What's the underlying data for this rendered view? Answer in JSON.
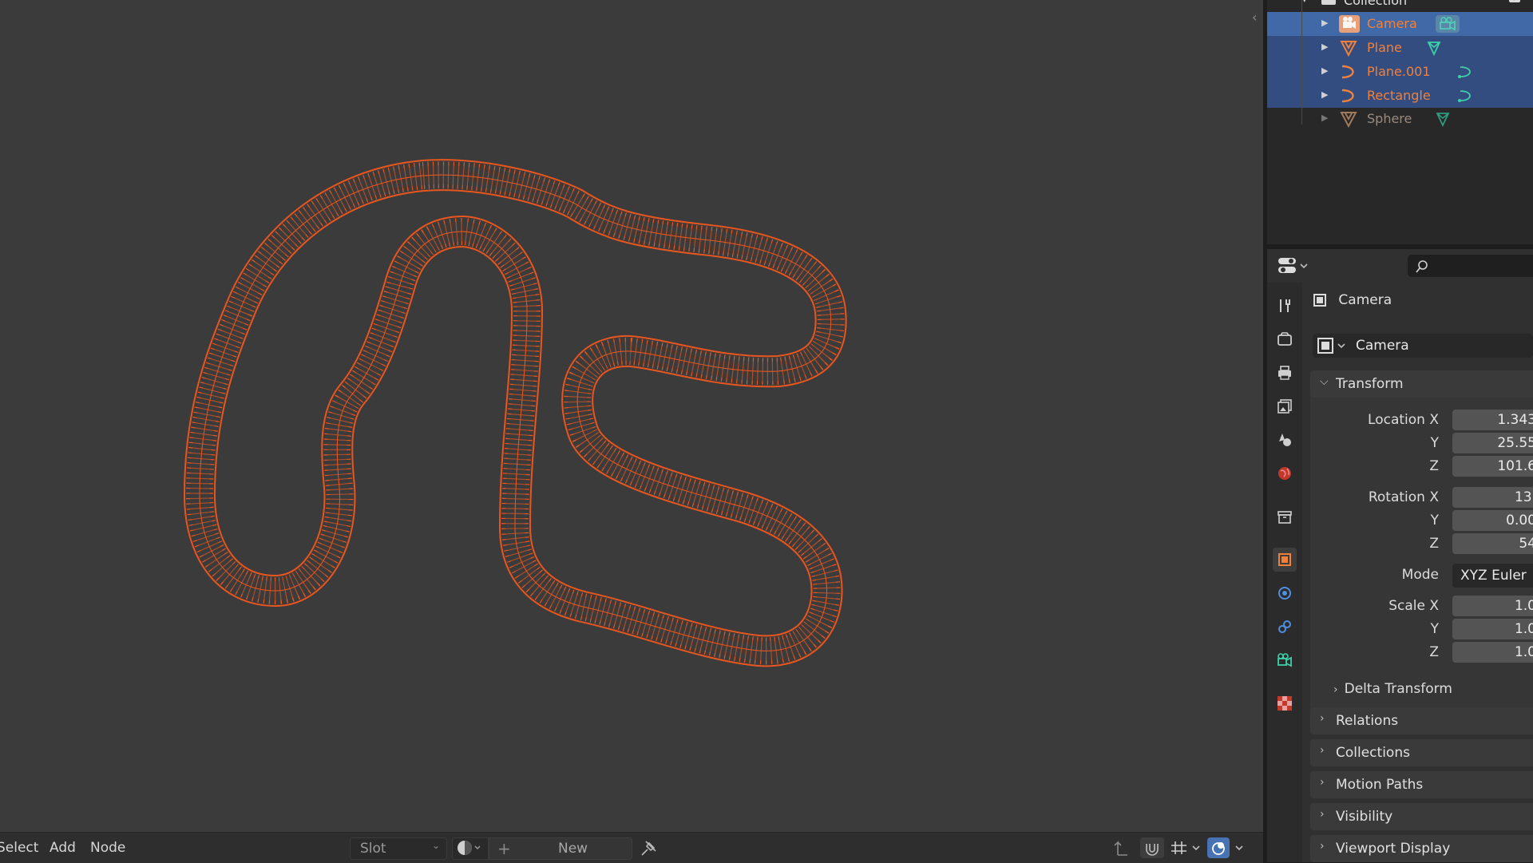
{
  "viewport": {
    "object_wire_color": "#e8561f",
    "background_color": "#3b3b3b"
  },
  "bottom_bar": {
    "menu_select": "Select",
    "menu_add": "Add",
    "menu_node": "Node",
    "slot_label": "Slot",
    "new_label": "New"
  },
  "outliner": {
    "collection_label": "Collection",
    "items": [
      {
        "name": "Camera",
        "selected": true
      },
      {
        "name": "Plane",
        "selected": true
      },
      {
        "name": "Plane.001",
        "selected": true
      },
      {
        "name": "Rectangle",
        "selected": true
      },
      {
        "name": "Sphere",
        "selected": false
      }
    ]
  },
  "properties": {
    "context_object": "Camera",
    "object_name": "Camera",
    "transform_title": "Transform",
    "location_label": "Location X",
    "location_x": "1.343",
    "location_y": "25.55",
    "location_z": "101.6",
    "rotation_label": "Rotation X",
    "rotation_x": "13.",
    "rotation_y": "0.00",
    "rotation_z": "54",
    "mode_label": "Mode",
    "mode_value": "XYZ Euler",
    "scale_label": "Scale X",
    "scale_x": "1.0",
    "scale_y": "1.0",
    "scale_z": "1.0",
    "axis_y": "Y",
    "axis_z": "Z",
    "delta_transform": "Delta Transform",
    "panels": [
      "Relations",
      "Collections",
      "Motion Paths",
      "Visibility",
      "Viewport Display"
    ]
  }
}
